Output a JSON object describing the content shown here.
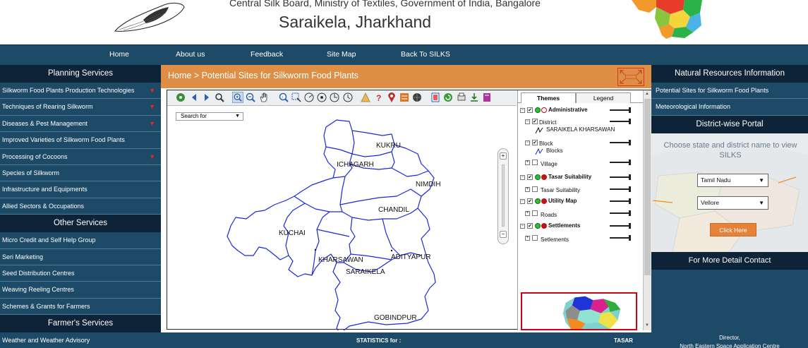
{
  "header": {
    "board_line": "Central Silk Board, Ministry of Textiles, Government of India, Bangalore",
    "site_title": "Saraikela, Jharkhand"
  },
  "nav": {
    "items": [
      "Home",
      "About us",
      "Feedback",
      "Site Map",
      "Back To SILKS"
    ]
  },
  "left_sidebar": {
    "planning_title": "Planning Services",
    "planning_items": [
      {
        "label": "Silkworm Food Plants Production Technologies",
        "has_arrow": true
      },
      {
        "label": "Techniques of Rearing Silkworm",
        "has_arrow": true
      },
      {
        "label": "Diseases & Pest Management",
        "has_arrow": true
      },
      {
        "label": "Improved Varieties of Silkworm Food Plants",
        "has_arrow": false
      },
      {
        "label": "Processing of Cocoons",
        "has_arrow": true
      },
      {
        "label": "Species of Silkworm",
        "has_arrow": false
      },
      {
        "label": "Infrastructure and Equipments",
        "has_arrow": false
      },
      {
        "label": "Allied Sectors & Occupations",
        "has_arrow": false
      }
    ],
    "other_title": "Other Services",
    "other_items": [
      "Micro Credit and Self Help Group",
      "Seri Marketing",
      "Seed Distribution Centres",
      "Weaving Reeling Centres",
      "Schemes & Grants for Farmers"
    ],
    "farmer_title": "Farmer's Services",
    "farmer_items": [
      "Weather and Weather Advisory"
    ],
    "arrow_glyph": "▼"
  },
  "breadcrumb": "Home > Potential Sites for Silkworm Food Plants",
  "map": {
    "search_placeholder": "Search for",
    "districts": [
      "KUKRU",
      "ICHAGARH",
      "NIMDIH",
      "CHANDIL",
      "KUCHAI",
      "KHARSAWAN",
      "ADITYAPUR",
      "SARAIKELA",
      "GOBINDPUR"
    ]
  },
  "layers": {
    "tabs": [
      "Themes",
      "Legend"
    ],
    "groups": [
      {
        "name": "Administrative",
        "children": [
          {
            "name": "District",
            "legend": "SARAIKELA KHARSAWAN",
            "checked": true
          },
          {
            "name": "Block",
            "legend": "Blocks",
            "checked": true
          },
          {
            "name": "Village",
            "checked": false
          }
        ]
      },
      {
        "name": "Tasar Suitability",
        "children": [
          {
            "name": "Tasar Suitability",
            "checked": false
          }
        ]
      },
      {
        "name": "Utility Map",
        "children": [
          {
            "name": "Roads",
            "checked": false
          }
        ]
      },
      {
        "name": "Settlements",
        "children": [
          {
            "name": "Setlements",
            "checked": false
          }
        ]
      }
    ]
  },
  "stats": {
    "label": "STATISTICS for :",
    "value": "TASAR"
  },
  "right_sidebar": {
    "natural_title": "Natural Resources Information",
    "natural_items": [
      "Potential Sites for Silkworm Food Plants",
      "Meteorological Information"
    ],
    "portal_title": "District-wise Portal",
    "portal_prompt": "Choose state and district name to view SILKS",
    "state_value": "Tamil Nadu",
    "district_value": "Vellore",
    "click_here": "Click Here",
    "detail_title": "For More Detail Contact",
    "footer_line1": "Director,",
    "footer_line2": "North Eastern Space Application Centre"
  },
  "colors": {
    "nav_bg": "#1d4a66",
    "sidebar_head": "#0d2337",
    "breadcrumb_bg": "#df8f45",
    "boundary": "#1a2ad6",
    "arrow_red": "#e8262a"
  }
}
